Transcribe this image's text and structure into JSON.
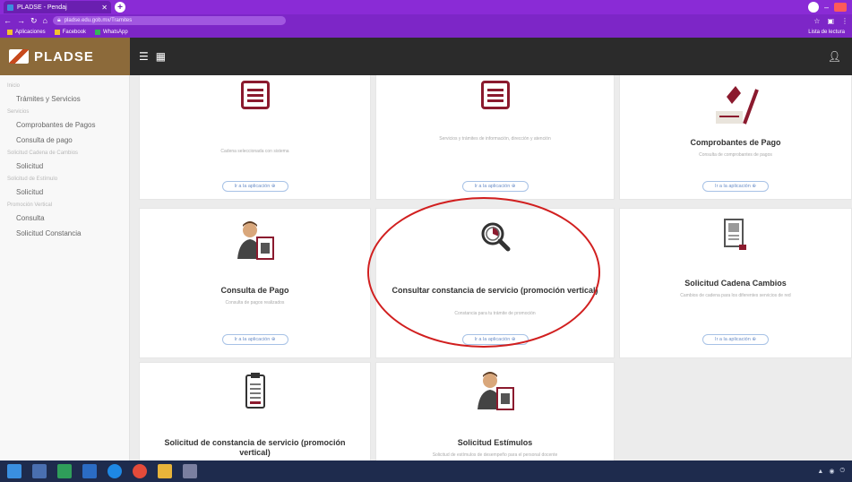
{
  "browser": {
    "tab_title": "PLADSE - Pendaj",
    "url": "pladse.edu.gob.mx/Tramites",
    "bookmarks": [
      "Aplicaciones",
      "Facebook",
      "WhatsApp"
    ],
    "bookmarks_right": "Lista de lectura"
  },
  "app": {
    "logo_text": "PLADSE",
    "menu_icons": [
      "hamburger-icon",
      "grid-icon"
    ],
    "user_icon": "user-icon"
  },
  "sidebar": {
    "sections": [
      {
        "label": "Inicio",
        "items": [
          "Trámites y Servicios"
        ]
      },
      {
        "label": "Servicios",
        "items": [
          "Comprobantes de Pagos",
          "Consulta de pago"
        ]
      },
      {
        "label": "Solicitud Cadena de Cambios",
        "items": [
          "Solicitud"
        ]
      },
      {
        "label": "Solicitud de Estímulo",
        "items": [
          "Solicitud"
        ]
      },
      {
        "label": "Promoción Vertical",
        "items": [
          "Consulta",
          "Solicitud Constancia"
        ]
      }
    ]
  },
  "cards": [
    {
      "title": "",
      "desc": "Cadena seleccionada con sistema",
      "btn": "Ir a la aplicación ⊕",
      "icon": "list-icon"
    },
    {
      "title": "",
      "desc": "Servicios y trámites de información, dirección y atención",
      "btn": "Ir a la aplicación ⊕",
      "icon": "list-icon"
    },
    {
      "title": "Comprobantes de Pago",
      "desc": "Consulta de comprobantes de pagos",
      "btn": "Ir a la aplicación ⊕",
      "icon": "signature-icon"
    },
    {
      "title": "Consulta de Pago",
      "desc": "Consulta de pagos realizados",
      "btn": "Ir a la aplicación ⊕",
      "icon": "person-document-icon"
    },
    {
      "title": "Consultar constancia de servicio (promoción vertical)",
      "desc": "Constancia para tu trámite de promoción",
      "btn": "Ir a la aplicación ⊕",
      "icon": "magnifier-chart-icon"
    },
    {
      "title": "Solicitud Cadena Cambios",
      "desc": "Cambios de cadena para los diferentes servicios de red",
      "btn": "Ir a la aplicación ⊕",
      "icon": "document-icon"
    },
    {
      "title": "Solicitud de constancia de servicio (promoción vertical)",
      "desc": "",
      "btn": "",
      "icon": "clipboard-icon"
    },
    {
      "title": "Solicitud Estímulos",
      "desc": "Solicitud de estímulos de desempeño para el personal docente",
      "btn": "",
      "icon": "person-document-icon"
    }
  ],
  "colors": {
    "brand": "#8c6a3a",
    "accent": "#8b1a2e",
    "browser": "#7d26c7",
    "highlight": "#d11f1f"
  }
}
